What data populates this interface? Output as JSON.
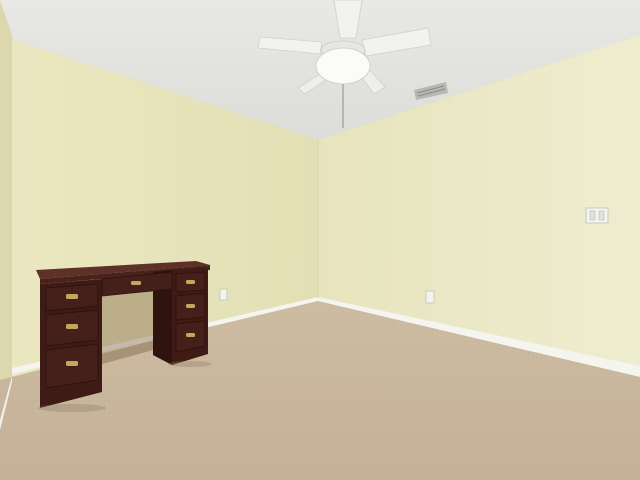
{
  "scene": {
    "description_none": "",
    "colors": {
      "ceiling": "#e9e9e6",
      "left_wall": "#e4dfb6",
      "right_wall": "#ecebc6",
      "back_wall": "#e6e2b8",
      "carpet": "#c9b79e",
      "baseboard": "#f7f7f2",
      "desk": "#3f1c16",
      "desk_top": "#5a2f27",
      "hardware": "#c7a55d",
      "fan": "#f1f1ef"
    },
    "desk": {
      "left_drawers": 3,
      "right_drawers": 3
    }
  }
}
